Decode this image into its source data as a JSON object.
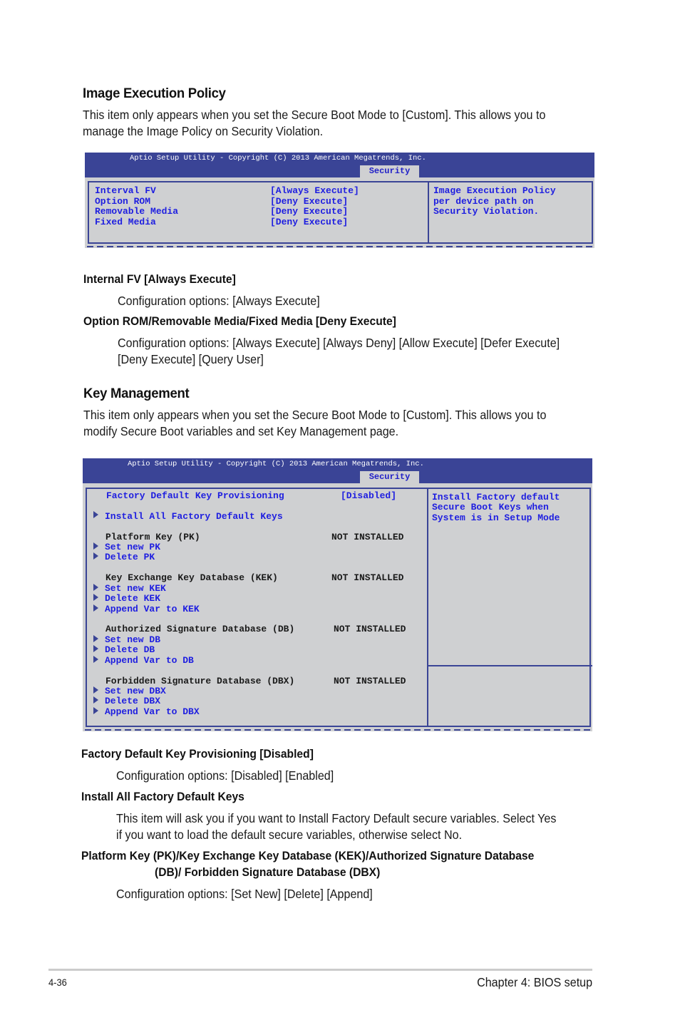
{
  "section1": {
    "title": "Image Execution Policy",
    "description_lines": [
      "This item only appears when you set the Secure Boot Mode to [Custom]. This allows you to",
      "manage the Image Policy on Security Violation."
    ],
    "bios": {
      "copyright": "Aptio Setup Utility - Copyright (C) 2013 American Megatrends, Inc.",
      "active_tab": "Security",
      "items": [
        {
          "label": "Interval FV",
          "value": "[Always Execute]"
        },
        {
          "label": "Option ROM",
          "value": "[Deny Execute]"
        },
        {
          "label": "Removable Media",
          "value": "[Deny Execute]"
        },
        {
          "label": "Fixed Media",
          "value": "[Deny Execute]"
        }
      ],
      "help_lines": [
        "Image Execution Policy",
        "per device path on",
        "Security Violation."
      ]
    },
    "subsections": [
      {
        "heading": "Internal FV [Always Execute]",
        "text_lines": [
          "Configuration options: [Always Execute]"
        ]
      },
      {
        "heading": "Option ROM/Removable Media/Fixed Media [Deny Execute]",
        "text_lines": [
          "Configuration options: [Always Execute] [Always Deny] [Allow Execute] [Defer Execute]",
          "[Deny Execute] [Query User]"
        ]
      }
    ]
  },
  "section2": {
    "title": "Key Management",
    "description_lines": [
      "This item only appears when you set the Secure Boot Mode to [Custom]. This allows you to",
      "modify Secure Boot variables and set Key Management page."
    ],
    "bios": {
      "copyright": "Aptio Setup Utility - Copyright (C) 2013 American Megatrends, Inc.",
      "active_tab": "Security",
      "provisioning": {
        "label": "Factory Default Key Provisioning",
        "value": "[Disabled]"
      },
      "install_all": "Install All Factory Default Keys",
      "groups": [
        {
          "label": "Platform Key (PK)",
          "status": "NOT INSTALLED",
          "actions": [
            "Set new PK",
            "Delete PK"
          ]
        },
        {
          "label": "Key Exchange Key Database (KEK)",
          "status": "NOT INSTALLED",
          "actions": [
            "Set new KEK",
            "Delete KEK",
            "Append Var to KEK"
          ]
        },
        {
          "label": "Authorized Signature Database (DB)",
          "status": "NOT INSTALLED",
          "actions": [
            "Set new DB",
            "Delete DB",
            "Append Var to DB"
          ]
        },
        {
          "label": "Forbidden Signature Database (DBX)",
          "status": "NOT INSTALLED",
          "actions": [
            "Set new DBX",
            "Delete DBX",
            "Append Var to DBX"
          ]
        }
      ],
      "help_lines": [
        "Install Factory default",
        "Secure Boot Keys when",
        "System is in Setup Mode"
      ]
    },
    "subsections": [
      {
        "heading": "Factory Default Key Provisioning [Disabled]",
        "text_lines": [
          "Configuration options: [Disabled] [Enabled]"
        ]
      },
      {
        "heading": "Install All Factory Default Keys",
        "text_lines": [
          "This item will ask you if you want to Install Factory Default secure variables. Select Yes",
          "if you want to load the default secure variables, otherwise select No."
        ]
      },
      {
        "heading_lines": [
          "Platform Key (PK)/Key Exchange Key Database (KEK)/Authorized Signature Database",
          "(DB)/ Forbidden Signature Database (DBX)"
        ],
        "text_lines": [
          "Configuration options: [Set New] [Delete] [Append]"
        ]
      }
    ]
  },
  "footer": {
    "page_number": "4-36",
    "chapter": "Chapter 4: BIOS setup"
  },
  "colors": {
    "bios_header": "#3a4496",
    "bios_background": "#cfd0d2",
    "bios_item_text": "#1e1ee0"
  }
}
